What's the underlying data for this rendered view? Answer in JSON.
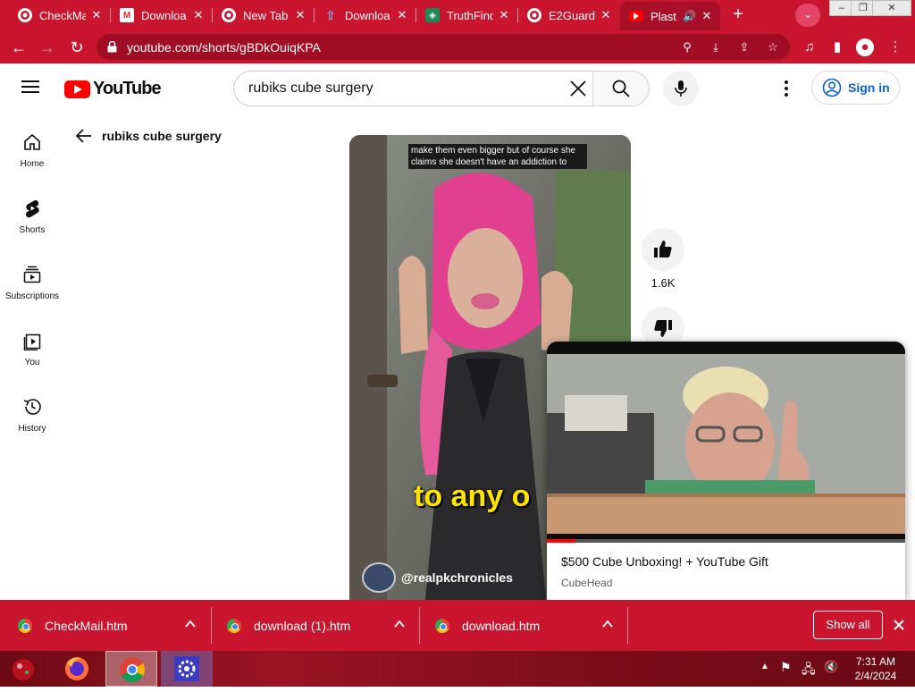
{
  "browser": {
    "tabs": [
      {
        "title": "CheckMa",
        "favicon": "gmail-like-icon"
      },
      {
        "title": "Downloa",
        "favicon": "gmail-icon"
      },
      {
        "title": "New Tab",
        "favicon": "chrome-icon"
      },
      {
        "title": "Downloa",
        "favicon": "upload-icon"
      },
      {
        "title": "TruthFind",
        "favicon": "flag-icon"
      },
      {
        "title": "E2Guard",
        "favicon": "globe-icon"
      },
      {
        "title": "Plast",
        "favicon": "youtube-icon",
        "active": true
      }
    ],
    "url": "youtube.com/shorts/gBDkOuiqKPA",
    "accent_color": "#c9152e"
  },
  "youtube": {
    "logo_text": "YouTube",
    "search_value": "rubiks cube surgery",
    "signin_label": "Sign in",
    "nav": [
      {
        "label": "Home",
        "icon": "home-icon"
      },
      {
        "label": "Shorts",
        "icon": "shorts-icon"
      },
      {
        "label": "Subscriptions",
        "icon": "subscriptions-icon"
      },
      {
        "label": "You",
        "icon": "you-icon"
      },
      {
        "label": "History",
        "icon": "history-icon"
      }
    ],
    "back_title": "rubiks cube surgery",
    "short": {
      "caption_top": "make them even bigger but of course she claims she doesn't have an addiction to",
      "caption_big": "to any o",
      "channel": "@realpkchronicles",
      "likes": "1.6K"
    },
    "miniplayer": {
      "title": "$500 Cube Unboxing! + YouTube Gift",
      "channel": "CubeHead",
      "progress": 0.08
    }
  },
  "downloads": {
    "items": [
      "CheckMail.htm",
      "download (1).htm",
      "download.htm"
    ],
    "show_all": "Show all"
  },
  "taskbar": {
    "time": "7:31 AM",
    "date": "2/4/2024"
  }
}
